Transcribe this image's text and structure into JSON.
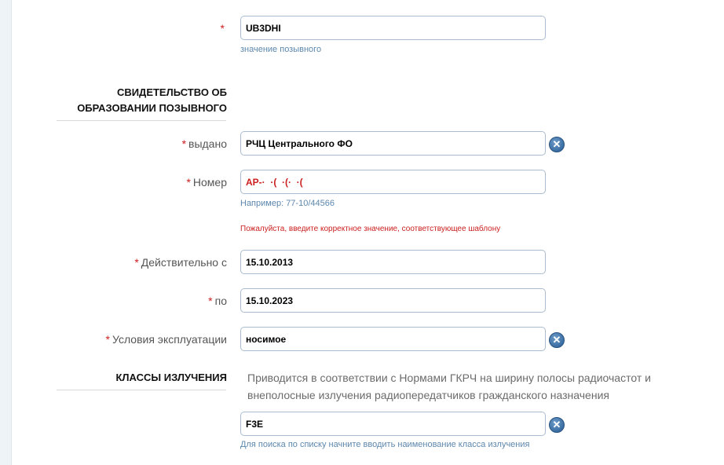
{
  "callsign": {
    "required_mark": "*",
    "value": "UB3DHI",
    "hint": "значение позывного"
  },
  "certificate_section": {
    "title_line1": "СВИДЕТЕЛЬСТВО ОБ",
    "title_line2": "ОБРАЗОВАНИИ ПОЗЫВНОГО"
  },
  "issued_by": {
    "required_mark": "*",
    "label": "выдано",
    "value": "РЧЦ Центрального ФО"
  },
  "number": {
    "required_mark": "*",
    "label": "Номер",
    "value": "АР-·  ·(  ·(·  ·(",
    "hint": "Например: 77-10/44566",
    "error": "Пожалуйста, введите корректное значение, соответствующее шаблону"
  },
  "valid_from": {
    "required_mark": "*",
    "label": "Действительно с",
    "value": "15.10.2013"
  },
  "valid_to": {
    "required_mark": "*",
    "label": "по",
    "value": "15.10.2023"
  },
  "operating_conditions": {
    "required_mark": "*",
    "label": "Условия эксплуатации",
    "value": "носимое"
  },
  "emission_classes": {
    "title": "КЛАССЫ ИЗЛУЧЕНИЯ",
    "note": "Приводится в соответствии с Нормами ГКРЧ на ширину полосы радиочастот и внеполосные излучения радиопередатчиков гражданского назначения",
    "value": "F3E",
    "hint": "Для поиска по списку начните вводить наименование класса излучения"
  },
  "clear_icon_glyph": "✕",
  "colors": {
    "required": "#cc1e1e",
    "hint": "#5d87ad",
    "input_border": "#a9bcd0",
    "clear_button": "#3a6ea3"
  }
}
